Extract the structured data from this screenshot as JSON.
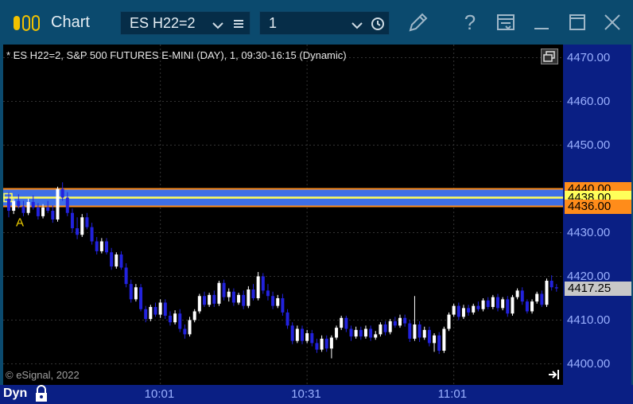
{
  "window": {
    "title": "Chart",
    "symbol_value": "ES H22=2",
    "interval_value": "1",
    "help_label": "?"
  },
  "chart": {
    "label": "* ES H22=2, S&P 500 FUTURES E-MINI (DAY), 1, 09:30-16:15 (Dynamic)",
    "copyright": "© eSignal, 2022",
    "marker_label": "A",
    "mode_label": "Dyn"
  },
  "colors": {
    "background": "#000000",
    "axis_bg": "#0a1f84",
    "candle_up": "#ffffff",
    "candle_down": "#2222dd",
    "band_fill": "#3e6fe6",
    "band_outline": "#ff8c1a",
    "band_center": "#ffff5a",
    "price_tag": "#c8c8c8"
  },
  "chart_data": {
    "type": "candlestick",
    "ylim": [
      4398.5,
      4473.0
    ],
    "yticks": [
      "4470.00",
      "4460.00",
      "4450.00",
      "4440.00",
      "4430.00",
      "4420.00",
      "4410.00",
      "4400.00"
    ],
    "xticks": [
      {
        "label": "10:01",
        "bar": 31
      },
      {
        "label": "10:31",
        "bar": 61
      },
      {
        "label": "11:01",
        "bar": 91
      }
    ],
    "band": {
      "upper": 4440.0,
      "middle": 4438.0,
      "lower": 4436.0
    },
    "band_tags": [
      "4440.00",
      "4438.00",
      "4436.00"
    ],
    "last_price_tag": "4417.25",
    "bars_ohlc": [
      [
        4437.75,
        4439.25,
        4433.5,
        4435.0
      ],
      [
        4435.0,
        4437.75,
        4434.25,
        4437.25
      ],
      [
        4437.25,
        4438.75,
        4435.5,
        4436.0
      ],
      [
        4436.0,
        4437.25,
        4433.75,
        4434.5
      ],
      [
        4434.5,
        4437.75,
        4434.0,
        4437.0
      ],
      [
        4437.0,
        4438.5,
        4435.25,
        4435.75
      ],
      [
        4435.75,
        4436.75,
        4433.0,
        4433.75
      ],
      [
        4433.75,
        4436.5,
        4433.25,
        4435.75
      ],
      [
        4435.75,
        4437.25,
        4434.5,
        4435.0
      ],
      [
        4435.0,
        4436.25,
        4432.25,
        4433.0
      ],
      [
        4433.0,
        4440.5,
        4432.5,
        4440.0
      ],
      [
        4440.0,
        4441.5,
        4437.25,
        4438.0
      ],
      [
        4438.0,
        4439.25,
        4433.75,
        4434.5
      ],
      [
        4434.5,
        4435.5,
        4430.0,
        4431.0
      ],
      [
        4431.0,
        4433.5,
        4428.5,
        4429.5
      ],
      [
        4429.5,
        4434.25,
        4429.0,
        4433.5
      ],
      [
        4433.5,
        4434.5,
        4430.75,
        4431.25
      ],
      [
        4431.25,
        4432.25,
        4427.25,
        4428.0
      ],
      [
        4428.0,
        4429.0,
        4425.0,
        4425.75
      ],
      [
        4425.75,
        4428.75,
        4425.25,
        4428.0
      ],
      [
        4428.0,
        4428.75,
        4425.0,
        4425.5
      ],
      [
        4425.5,
        4426.5,
        4421.5,
        4422.25
      ],
      [
        4422.25,
        4425.5,
        4421.75,
        4425.0
      ],
      [
        4425.0,
        4425.75,
        4421.5,
        4422.0
      ],
      [
        4422.0,
        4423.0,
        4417.5,
        4418.25
      ],
      [
        4418.25,
        4419.25,
        4414.0,
        4414.75
      ],
      [
        4414.75,
        4418.25,
        4414.25,
        4417.5
      ],
      [
        4417.5,
        4418.25,
        4412.0,
        4412.5
      ],
      [
        4412.5,
        4413.25,
        4409.5,
        4410.25
      ],
      [
        4410.25,
        4413.5,
        4409.75,
        4413.0
      ],
      [
        4413.0,
        4414.0,
        4410.75,
        4411.25
      ],
      [
        4411.25,
        4414.75,
        4410.5,
        4414.0
      ],
      [
        4414.0,
        4414.75,
        4410.25,
        4411.0
      ],
      [
        4411.0,
        4412.0,
        4408.75,
        4409.5
      ],
      [
        4409.5,
        4412.25,
        4409.0,
        4411.5
      ],
      [
        4411.5,
        4412.5,
        4407.25,
        4408.0
      ],
      [
        4408.0,
        4409.0,
        4405.75,
        4406.75
      ],
      [
        4406.75,
        4410.75,
        4406.25,
        4410.0
      ],
      [
        4410.0,
        4412.5,
        4409.5,
        4412.0
      ],
      [
        4412.0,
        4416.0,
        4411.5,
        4415.5
      ],
      [
        4415.5,
        4416.5,
        4413.0,
        4413.5
      ],
      [
        4413.5,
        4416.25,
        4413.0,
        4415.75
      ],
      [
        4415.75,
        4416.75,
        4413.0,
        4413.75
      ],
      [
        4413.75,
        4419.0,
        4413.25,
        4418.5
      ],
      [
        4418.5,
        4419.25,
        4414.5,
        4415.25
      ],
      [
        4415.25,
        4417.25,
        4414.25,
        4416.5
      ],
      [
        4416.5,
        4417.25,
        4413.25,
        4414.0
      ],
      [
        4414.0,
        4416.25,
        4413.5,
        4415.75
      ],
      [
        4415.75,
        4416.75,
        4412.5,
        4413.25
      ],
      [
        4413.25,
        4417.75,
        4412.75,
        4417.0
      ],
      [
        4417.0,
        4418.25,
        4414.5,
        4415.0
      ],
      [
        4415.0,
        4421.0,
        4414.5,
        4420.0
      ],
      [
        4420.0,
        4420.75,
        4416.0,
        4416.75
      ],
      [
        4416.75,
        4418.25,
        4414.5,
        4415.5
      ],
      [
        4415.5,
        4416.5,
        4412.5,
        4413.25
      ],
      [
        4413.25,
        4415.75,
        4412.75,
        4415.0
      ],
      [
        4415.0,
        4416.0,
        4411.0,
        4411.75
      ],
      [
        4411.75,
        4412.5,
        4408.0,
        4408.75
      ],
      [
        4408.75,
        4409.5,
        4404.5,
        4405.25
      ],
      [
        4405.25,
        4408.75,
        4404.75,
        4408.0
      ],
      [
        4408.0,
        4408.75,
        4404.5,
        4405.25
      ],
      [
        4405.25,
        4407.75,
        4404.75,
        4407.0
      ],
      [
        4407.0,
        4407.75,
        4404.0,
        4404.75
      ],
      [
        4404.75,
        4405.75,
        4402.5,
        4403.25
      ],
      [
        4403.25,
        4406.5,
        4402.75,
        4405.75
      ],
      [
        4405.75,
        4406.5,
        4402.75,
        4403.5
      ],
      [
        4403.5,
        4406.5,
        4401.25,
        4406.0
      ],
      [
        4406.0,
        4408.75,
        4405.5,
        4408.25
      ],
      [
        4408.25,
        4411.0,
        4407.75,
        4410.5
      ],
      [
        4410.5,
        4411.0,
        4407.25,
        4408.0
      ],
      [
        4408.0,
        4408.75,
        4405.25,
        4406.25
      ],
      [
        4406.25,
        4408.5,
        4405.75,
        4407.75
      ],
      [
        4407.75,
        4408.5,
        4405.5,
        4406.25
      ],
      [
        4406.25,
        4408.75,
        4405.75,
        4408.0
      ],
      [
        4408.0,
        4408.75,
        4405.25,
        4406.0
      ],
      [
        4406.0,
        4407.5,
        4405.5,
        4406.75
      ],
      [
        4406.75,
        4409.5,
        4406.25,
        4409.0
      ],
      [
        4409.0,
        4409.75,
        4406.5,
        4407.25
      ],
      [
        4407.25,
        4410.25,
        4406.75,
        4409.75
      ],
      [
        4409.75,
        4410.75,
        4408.25,
        4408.75
      ],
      [
        4408.75,
        4411.25,
        4408.25,
        4410.5
      ],
      [
        4410.5,
        4411.25,
        4408.5,
        4409.25
      ],
      [
        4409.25,
        4410.0,
        4405.0,
        4405.75
      ],
      [
        4405.75,
        4415.5,
        4405.25,
        4409.0
      ],
      [
        4409.0,
        4409.75,
        4405.0,
        4406.0
      ],
      [
        4406.0,
        4408.5,
        4405.5,
        4407.75
      ],
      [
        4407.75,
        4408.5,
        4404.0,
        4404.75
      ],
      [
        4404.75,
        4407.0,
        4402.75,
        4406.5
      ],
      [
        4406.5,
        4407.25,
        4402.25,
        4403.0
      ],
      [
        4403.0,
        4408.5,
        4402.5,
        4408.0
      ],
      [
        4408.0,
        4411.75,
        4407.5,
        4411.25
      ],
      [
        4411.25,
        4413.75,
        4410.75,
        4413.25
      ],
      [
        4413.25,
        4414.0,
        4410.0,
        4410.75
      ],
      [
        4410.75,
        4413.5,
        4410.25,
        4412.75
      ],
      [
        4412.75,
        4413.5,
        4411.0,
        4411.75
      ],
      [
        4411.75,
        4413.75,
        4411.25,
        4413.25
      ],
      [
        4413.25,
        4414.25,
        4412.0,
        4412.5
      ],
      [
        4412.5,
        4415.0,
        4412.0,
        4414.5
      ],
      [
        4414.5,
        4415.25,
        4412.5,
        4413.0
      ],
      [
        4413.0,
        4415.75,
        4412.5,
        4415.25
      ],
      [
        4415.25,
        4416.0,
        4412.0,
        4412.75
      ],
      [
        4412.75,
        4415.25,
        4412.25,
        4414.75
      ],
      [
        4414.75,
        4415.5,
        4410.75,
        4411.5
      ],
      [
        4411.5,
        4415.75,
        4411.0,
        4415.25
      ],
      [
        4415.25,
        4417.25,
        4414.75,
        4416.75
      ],
      [
        4416.75,
        4417.5,
        4413.5,
        4414.25
      ],
      [
        4414.25,
        4414.75,
        4411.5,
        4412.0
      ],
      [
        4412.0,
        4414.75,
        4411.5,
        4414.25
      ],
      [
        4414.25,
        4416.5,
        4413.75,
        4416.0
      ],
      [
        4416.0,
        4416.75,
        4413.0,
        4413.5
      ],
      [
        4413.5,
        4419.5,
        4413.0,
        4419.0
      ],
      [
        4419.0,
        4420.25,
        4416.75,
        4417.5
      ],
      [
        4417.5,
        4418.25,
        4416.5,
        4417.25
      ]
    ]
  }
}
